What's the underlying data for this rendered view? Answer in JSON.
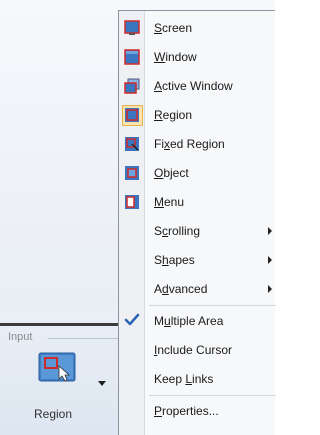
{
  "ribbon": {
    "group_label": "Input",
    "button_label": "Region"
  },
  "menu": {
    "items": [
      {
        "label": "Screen",
        "underline_index": 0,
        "icon": "screen-icon"
      },
      {
        "label": "Window",
        "underline_index": 0,
        "icon": "window-icon"
      },
      {
        "label": "Active Window",
        "underline_index": 0,
        "icon": "active-window-icon"
      },
      {
        "label": "Region",
        "underline_index": 0,
        "icon": "region-icon",
        "highlighted": true
      },
      {
        "label": "Fixed Region",
        "underline_index": 2,
        "icon": "fixed-region-icon"
      },
      {
        "label": "Object",
        "underline_index": 0,
        "icon": "object-icon"
      },
      {
        "label": "Menu",
        "underline_index": 0,
        "icon": "menu-icon"
      },
      {
        "label": "Scrolling",
        "underline_index": 1,
        "submenu": true
      },
      {
        "label": "Shapes",
        "underline_index": 1,
        "submenu": true
      },
      {
        "label": "Advanced",
        "underline_index": 1,
        "submenu": true
      },
      {
        "label": "Multiple Area",
        "underline_index": 1,
        "checked": true
      },
      {
        "label": "Include Cursor",
        "underline_index": 0
      },
      {
        "label": "Keep Links",
        "underline_index": 5
      },
      {
        "label": "Properties...",
        "underline_index": 0
      }
    ]
  },
  "colors": {
    "accent_red": "#cf2a2a",
    "icon_blue": "#3a76bf",
    "checkmark": "#2b63b5",
    "highlight": "#fbe3a9"
  }
}
